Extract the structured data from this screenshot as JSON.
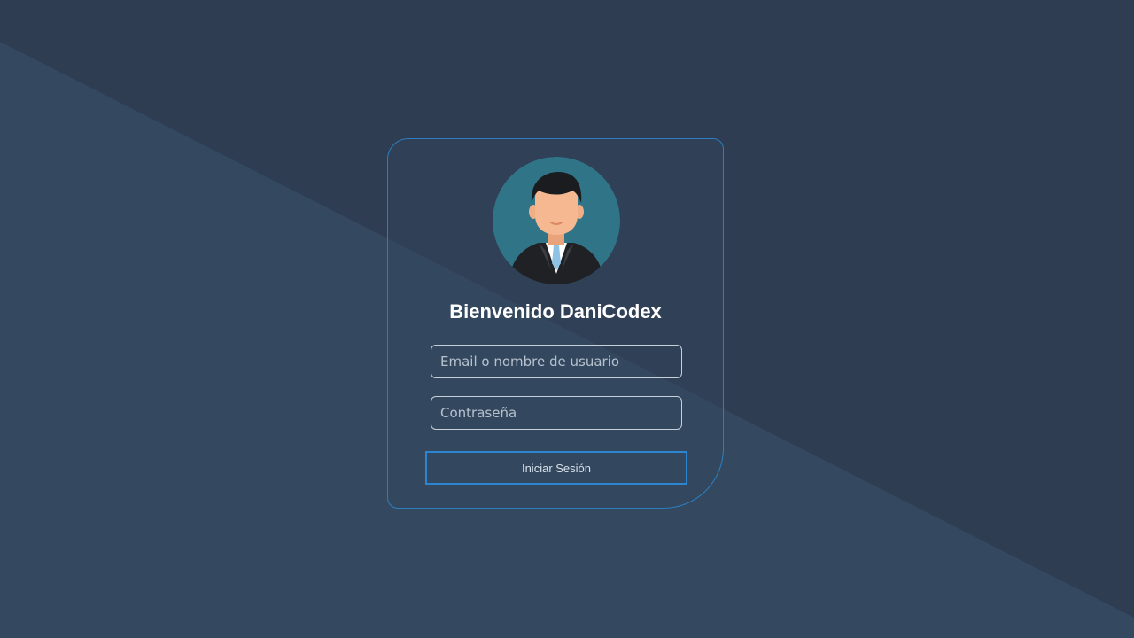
{
  "colors": {
    "background_dark": "#2e3d52",
    "background_light": "#34495f",
    "card_border": "#2b7fc0",
    "button_border": "#2b86cf",
    "avatar_circle": "#2f7487"
  },
  "login": {
    "avatar_icon": "user-avatar-icon",
    "title": "Bienvenido DaniCodex",
    "email_placeholder": "Email o nombre de usuario",
    "email_value": "",
    "password_placeholder": "Contraseña",
    "password_value": "",
    "submit_label": "Iniciar Sesión"
  }
}
